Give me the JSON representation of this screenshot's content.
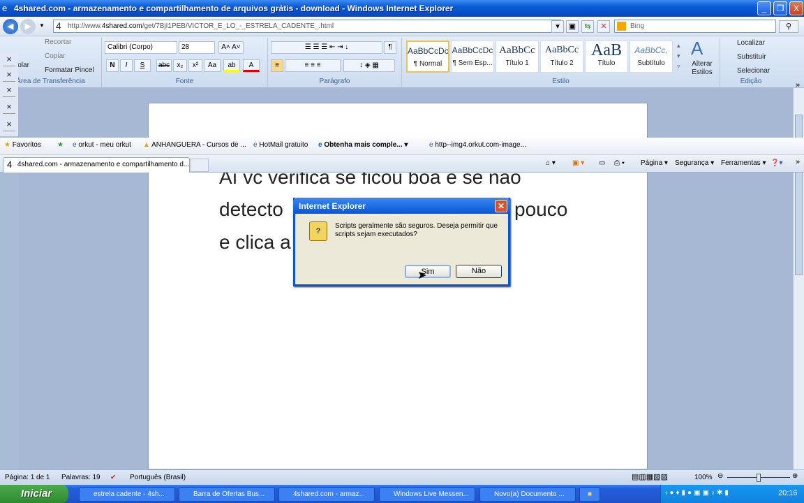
{
  "window": {
    "title": "4shared.com - armazenamento e compartilhamento de arquivos grátis - download - Windows Internet Explorer",
    "minimize": "_",
    "maximize": "❐",
    "close": "X"
  },
  "address": {
    "url_prefix": "http://www.",
    "url_domain": "4shared.com",
    "url_rest": "/get/7BjI1PEB/VICTOR_E_LO_-_ESTRELA_CADENTE_.html",
    "search_placeholder": "Bing"
  },
  "ribbon": {
    "clipboard": {
      "paste": "Colar",
      "cut": "Recortar",
      "copy": "Copiar",
      "format_painter": "Formatar Pincel",
      "label": "Área de Transferência"
    },
    "font": {
      "name": "Calibri (Corpo)",
      "size": "28",
      "bold": "N",
      "italic": "I",
      "underline": "S",
      "strike": "abc",
      "sub": "x₂",
      "sup": "x²",
      "case": "Aa",
      "label": "Fonte"
    },
    "paragraph": {
      "label": "Parágrafo",
      "pilcrow": "¶"
    },
    "styles": {
      "label": "Estilo",
      "items": [
        {
          "preview": "AaBbCcDc",
          "name": "¶ Normal"
        },
        {
          "preview": "AaBbCcDc",
          "name": "¶ Sem Esp..."
        },
        {
          "preview": "AaBbCc",
          "name": "Título 1"
        },
        {
          "preview": "AaBbCc",
          "name": "Título 2"
        },
        {
          "preview": "AaB",
          "name": "Título"
        },
        {
          "preview": "AaBbCc.",
          "name": "Subtítulo"
        }
      ],
      "change": "Alterar Estilos"
    },
    "editing": {
      "find": "Localizar",
      "replace": "Substituir",
      "select": "Selecionar",
      "label": "Edição"
    }
  },
  "favorites": {
    "label": "Favoritos",
    "items": [
      "orkut - meu orkut",
      "ANHANGUERA - Cursos de ...",
      "HotMail gratuito",
      "Obtenha mais comple...",
      "http--img4.orkut.com-image..."
    ]
  },
  "tab": {
    "title": "4shared.com - armazenamento e compartilhamento d..."
  },
  "commands": {
    "page": "Página",
    "security": "Segurança",
    "tools": "Ferramentas"
  },
  "document": {
    "line1": "Aí vc verifica se ficou boa e se não",
    "line2a": "detecto",
    "line2b": "pouco",
    "line3": "e clica a"
  },
  "dialog": {
    "title": "Internet Explorer",
    "message": "Scripts geralmente são seguros. Deseja permitir que scripts sejam executados?",
    "yes": "Sim",
    "no": "Não"
  },
  "status": {
    "page": "Página: 1 de 1",
    "words": "Palavras: 19",
    "language": "Português (Brasil)",
    "zoom": "100%",
    "zoom_value": 0.5
  },
  "taskbar": {
    "start": "Iniciar",
    "tasks": [
      "estrela cadente - 4sh...",
      "Barra de Ofertas Bus...",
      "4shared.com - armaz...",
      "Windows Live Messen...",
      "Novo(a) Documento ..."
    ],
    "clock": "20:16"
  }
}
